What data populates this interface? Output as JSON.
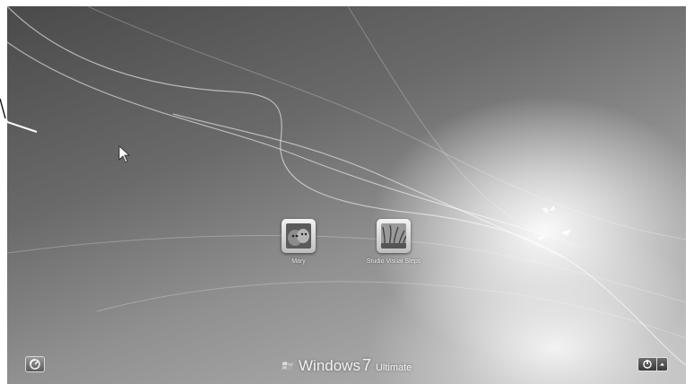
{
  "users": [
    {
      "name": "Mary",
      "picture": "cat-picture"
    },
    {
      "name": "Studio Visual Steps",
      "picture": "grass-picture"
    }
  ],
  "branding": {
    "word": "Windows",
    "version": "7",
    "edition": "Ultimate",
    "logo_icon": "windows-flag-icon"
  },
  "controls": {
    "ease_of_access_icon": "ease-of-access-icon",
    "power_icon": "power-icon",
    "power_menu_icon": "chevron-up-icon"
  },
  "colors": {
    "background_dark": "#4a4a4a",
    "background_light": "#ffffff",
    "text": "#f2f2f2"
  }
}
